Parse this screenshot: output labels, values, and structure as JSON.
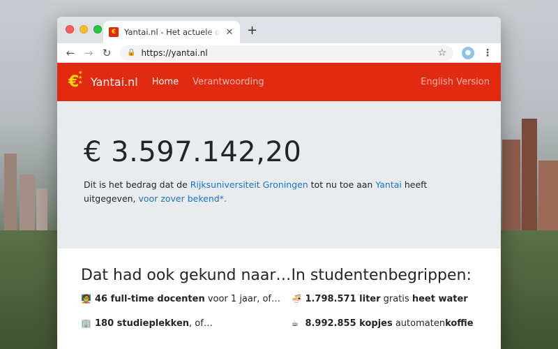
{
  "browser": {
    "tab_title": "Yantai.nl - Het actuele overzicht",
    "url": "https://yantai.nl"
  },
  "site": {
    "logo_symbol": "€",
    "logo_text": "Yantai.nl",
    "nav": {
      "home": "Home",
      "verantwoording": "Verantwoording",
      "english": "English Version"
    },
    "hero": {
      "amount": "€ 3.597.142,20",
      "text_prefix": "Dit is het bedrag dat de ",
      "link_rug": "Rijksuniversiteit Groningen",
      "text_mid": " tot nu toe aan ",
      "link_yantai": "Yantai",
      "text_suffix": " heeft uitgegeven, ",
      "link_known": "voor zover bekend*."
    },
    "left": {
      "heading": "Dat had ook gekund naar…",
      "items": [
        {
          "bold": "46 full-time docenten",
          "rest": " voor 1 jaar, of…"
        },
        {
          "bold": "180 studieplekken",
          "rest": ", of…"
        }
      ]
    },
    "right": {
      "heading": "In studentenbegrippen:",
      "items": [
        {
          "bold": "1.798.571 liter",
          "mid": " gratis ",
          "bold2": "heet water"
        },
        {
          "bold": "8.992.855 kopjes",
          "mid": " automaten",
          "bold2": "koffie"
        }
      ]
    }
  },
  "colors": {
    "brand_red": "#e02a12",
    "link_blue": "#1a73c9",
    "hero_bg": "#e9ecef"
  }
}
